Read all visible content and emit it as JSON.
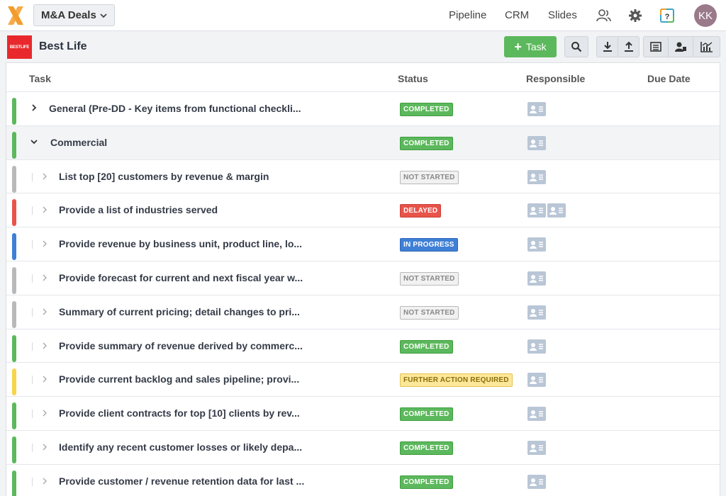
{
  "nav": {
    "deal_selector": "M&A Deals",
    "links": [
      "Pipeline",
      "CRM",
      "Slides"
    ],
    "icons": [
      "users-icon",
      "gear-icon",
      "help-icon"
    ],
    "avatar_initials": "KK",
    "brand_color": "#f39c2b"
  },
  "company": {
    "logo_text": "BESTLIFE",
    "name": "Best Life"
  },
  "toolbar": {
    "task_button": "Task",
    "tools": [
      "search-icon",
      "download-icon",
      "upload-icon",
      "list-view-icon",
      "assignees-icon",
      "analytics-icon"
    ]
  },
  "table": {
    "headers": {
      "task": "Task",
      "status": "Status",
      "responsible": "Responsible",
      "due_date": "Due Date"
    },
    "rows": [
      {
        "task": "General (Pre-DD - Key items from functional checkli...",
        "status": "COMPLETED",
        "level": 0,
        "expanded": false,
        "color": "#5cb85c",
        "responsible_count": 1
      },
      {
        "task": "Commercial",
        "status": "COMPLETED",
        "level": 0,
        "expanded": true,
        "color": "#5cb85c",
        "responsible_count": 1
      },
      {
        "task": "List top [20] customers by revenue & margin",
        "status": "NOT STARTED",
        "level": 1,
        "color": "#b9b9b9",
        "responsible_count": 1
      },
      {
        "task": "Provide a list of industries served",
        "status": "DELAYED",
        "level": 1,
        "color": "#e8534a",
        "responsible_count": 2
      },
      {
        "task": "Provide revenue by business unit, product line, lo...",
        "status": "IN PROGRESS",
        "level": 1,
        "color": "#3f7fd6",
        "responsible_count": 1
      },
      {
        "task": "Provide forecast for current and next fiscal year w...",
        "status": "NOT STARTED",
        "level": 1,
        "color": "#b9b9b9",
        "responsible_count": 1
      },
      {
        "task": "Summary of current pricing; detail changes to pri...",
        "status": "NOT STARTED",
        "level": 1,
        "color": "#b9b9b9",
        "responsible_count": 1
      },
      {
        "task": "Provide summary of revenue derived by commerc...",
        "status": "COMPLETED",
        "level": 1,
        "color": "#5cb85c",
        "responsible_count": 1
      },
      {
        "task": "Provide current backlog and sales pipeline; provi...",
        "status": "FURTHER ACTION REQUIRED",
        "level": 1,
        "color": "#f7d54a",
        "responsible_count": 1
      },
      {
        "task": "Provide client contracts for top [10] clients by rev...",
        "status": "COMPLETED",
        "level": 1,
        "color": "#5cb85c",
        "responsible_count": 1
      },
      {
        "task": "Identify any recent customer losses or likely depa...",
        "status": "COMPLETED",
        "level": 1,
        "color": "#5cb85c",
        "responsible_count": 1
      },
      {
        "task": "Provide customer / revenue retention data for last ...",
        "status": "COMPLETED",
        "level": 1,
        "color": "#5cb85c",
        "responsible_count": 1
      }
    ]
  }
}
